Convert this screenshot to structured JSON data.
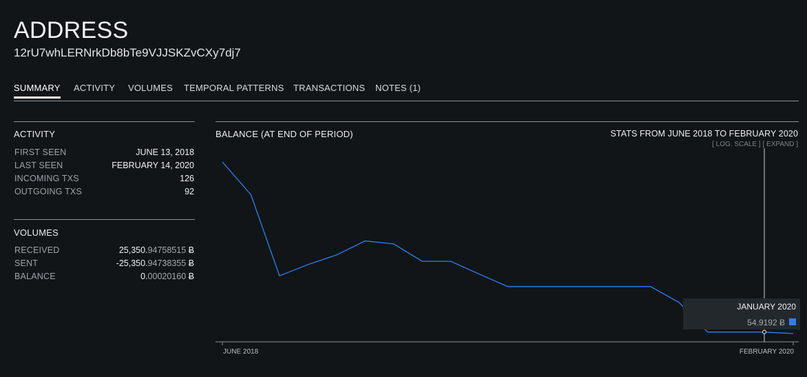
{
  "header": {
    "title": "ADDRESS",
    "address": "12rU7whLERNrkDb8bTe9VJJSKZvCXy7dj7"
  },
  "tabs": [
    {
      "label": "SUMMARY",
      "active": true
    },
    {
      "label": "ACTIVITY",
      "active": false
    },
    {
      "label": "VOLUMES",
      "active": false
    },
    {
      "label": "TEMPORAL PATTERNS",
      "active": false
    },
    {
      "label": "TRANSACTIONS",
      "active": false
    },
    {
      "label": "NOTES (1)",
      "active": false
    }
  ],
  "activity": {
    "title": "ACTIVITY",
    "rows": [
      {
        "label": "FIRST SEEN",
        "value": "JUNE 13, 2018"
      },
      {
        "label": "LAST SEEN",
        "value": "FEBRUARY 14, 2020"
      },
      {
        "label": "INCOMING TXS",
        "value": "126"
      },
      {
        "label": "OUTGOING TXS",
        "value": "92"
      }
    ]
  },
  "volumes": {
    "title": "VOLUMES",
    "rows": [
      {
        "label": "RECEIVED",
        "value_main": "25,350.",
        "value_dim": "94758515",
        "unit": "Ƀ"
      },
      {
        "label": "SENT",
        "value_main": "-25,350.",
        "value_dim": "94738355",
        "unit": "Ƀ"
      },
      {
        "label": "BALANCE",
        "value_main": "0.",
        "value_dim": "00020160",
        "unit": "Ƀ"
      }
    ]
  },
  "chart": {
    "title": "BALANCE (AT END OF PERIOD)",
    "range": "STATS FROM JUNE 2018 TO FEBRUARY 2020",
    "log_scale_link": "[ LOG. SCALE ]",
    "expand_link": "[ EXPAND ]",
    "x_start_label": "JUNE 2018",
    "x_end_label": "FEBRUARY 2020",
    "tooltip": {
      "date": "JANUARY 2020",
      "value": "54.9192 Ƀ"
    },
    "colors": {
      "line": "#2f80ed",
      "axis": "#8b9197",
      "cursor": "#c9cdd1"
    }
  },
  "chart_data": {
    "type": "line",
    "title": "BALANCE (AT END OF PERIOD)",
    "xlabel": "",
    "ylabel": "",
    "log_scale": true,
    "grid": false,
    "x": [
      "2018-06",
      "2018-07",
      "2018-08",
      "2018-09",
      "2018-10",
      "2018-11",
      "2018-12",
      "2019-01",
      "2019-02",
      "2019-03",
      "2019-04",
      "2019-05",
      "2019-06",
      "2019-07",
      "2019-08",
      "2019-09",
      "2019-10",
      "2019-11",
      "2019-12",
      "2020-01",
      "2020-02"
    ],
    "series": [
      {
        "values": [
          11000,
          3200,
          150,
          230,
          330,
          560,
          500,
          260,
          260,
          160,
          100,
          100,
          100,
          100,
          100,
          100,
          55,
          18,
          18,
          18,
          17
        ]
      }
    ],
    "highlight": {
      "x": "2020-01",
      "value": 54.9192
    }
  }
}
